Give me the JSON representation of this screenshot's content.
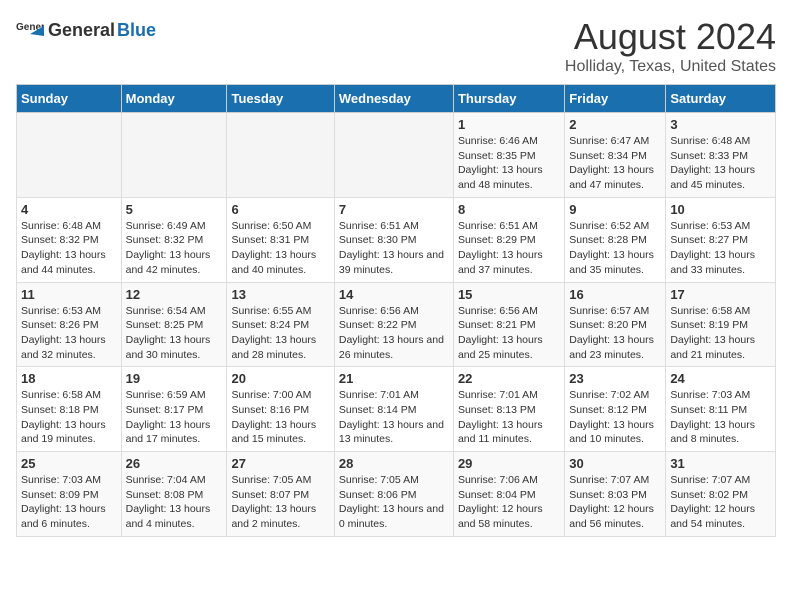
{
  "header": {
    "logo_general": "General",
    "logo_blue": "Blue",
    "title": "August 2024",
    "subtitle": "Holliday, Texas, United States"
  },
  "calendar": {
    "days_of_week": [
      "Sunday",
      "Monday",
      "Tuesday",
      "Wednesday",
      "Thursday",
      "Friday",
      "Saturday"
    ],
    "weeks": [
      [
        {
          "day": "",
          "sunrise": "",
          "sunset": "",
          "daylight": ""
        },
        {
          "day": "",
          "sunrise": "",
          "sunset": "",
          "daylight": ""
        },
        {
          "day": "",
          "sunrise": "",
          "sunset": "",
          "daylight": ""
        },
        {
          "day": "",
          "sunrise": "",
          "sunset": "",
          "daylight": ""
        },
        {
          "day": "1",
          "sunrise": "Sunrise: 6:46 AM",
          "sunset": "Sunset: 8:35 PM",
          "daylight": "Daylight: 13 hours and 48 minutes."
        },
        {
          "day": "2",
          "sunrise": "Sunrise: 6:47 AM",
          "sunset": "Sunset: 8:34 PM",
          "daylight": "Daylight: 13 hours and 47 minutes."
        },
        {
          "day": "3",
          "sunrise": "Sunrise: 6:48 AM",
          "sunset": "Sunset: 8:33 PM",
          "daylight": "Daylight: 13 hours and 45 minutes."
        }
      ],
      [
        {
          "day": "4",
          "sunrise": "Sunrise: 6:48 AM",
          "sunset": "Sunset: 8:32 PM",
          "daylight": "Daylight: 13 hours and 44 minutes."
        },
        {
          "day": "5",
          "sunrise": "Sunrise: 6:49 AM",
          "sunset": "Sunset: 8:32 PM",
          "daylight": "Daylight: 13 hours and 42 minutes."
        },
        {
          "day": "6",
          "sunrise": "Sunrise: 6:50 AM",
          "sunset": "Sunset: 8:31 PM",
          "daylight": "Daylight: 13 hours and 40 minutes."
        },
        {
          "day": "7",
          "sunrise": "Sunrise: 6:51 AM",
          "sunset": "Sunset: 8:30 PM",
          "daylight": "Daylight: 13 hours and 39 minutes."
        },
        {
          "day": "8",
          "sunrise": "Sunrise: 6:51 AM",
          "sunset": "Sunset: 8:29 PM",
          "daylight": "Daylight: 13 hours and 37 minutes."
        },
        {
          "day": "9",
          "sunrise": "Sunrise: 6:52 AM",
          "sunset": "Sunset: 8:28 PM",
          "daylight": "Daylight: 13 hours and 35 minutes."
        },
        {
          "day": "10",
          "sunrise": "Sunrise: 6:53 AM",
          "sunset": "Sunset: 8:27 PM",
          "daylight": "Daylight: 13 hours and 33 minutes."
        }
      ],
      [
        {
          "day": "11",
          "sunrise": "Sunrise: 6:53 AM",
          "sunset": "Sunset: 8:26 PM",
          "daylight": "Daylight: 13 hours and 32 minutes."
        },
        {
          "day": "12",
          "sunrise": "Sunrise: 6:54 AM",
          "sunset": "Sunset: 8:25 PM",
          "daylight": "Daylight: 13 hours and 30 minutes."
        },
        {
          "day": "13",
          "sunrise": "Sunrise: 6:55 AM",
          "sunset": "Sunset: 8:24 PM",
          "daylight": "Daylight: 13 hours and 28 minutes."
        },
        {
          "day": "14",
          "sunrise": "Sunrise: 6:56 AM",
          "sunset": "Sunset: 8:22 PM",
          "daylight": "Daylight: 13 hours and 26 minutes."
        },
        {
          "day": "15",
          "sunrise": "Sunrise: 6:56 AM",
          "sunset": "Sunset: 8:21 PM",
          "daylight": "Daylight: 13 hours and 25 minutes."
        },
        {
          "day": "16",
          "sunrise": "Sunrise: 6:57 AM",
          "sunset": "Sunset: 8:20 PM",
          "daylight": "Daylight: 13 hours and 23 minutes."
        },
        {
          "day": "17",
          "sunrise": "Sunrise: 6:58 AM",
          "sunset": "Sunset: 8:19 PM",
          "daylight": "Daylight: 13 hours and 21 minutes."
        }
      ],
      [
        {
          "day": "18",
          "sunrise": "Sunrise: 6:58 AM",
          "sunset": "Sunset: 8:18 PM",
          "daylight": "Daylight: 13 hours and 19 minutes."
        },
        {
          "day": "19",
          "sunrise": "Sunrise: 6:59 AM",
          "sunset": "Sunset: 8:17 PM",
          "daylight": "Daylight: 13 hours and 17 minutes."
        },
        {
          "day": "20",
          "sunrise": "Sunrise: 7:00 AM",
          "sunset": "Sunset: 8:16 PM",
          "daylight": "Daylight: 13 hours and 15 minutes."
        },
        {
          "day": "21",
          "sunrise": "Sunrise: 7:01 AM",
          "sunset": "Sunset: 8:14 PM",
          "daylight": "Daylight: 13 hours and 13 minutes."
        },
        {
          "day": "22",
          "sunrise": "Sunrise: 7:01 AM",
          "sunset": "Sunset: 8:13 PM",
          "daylight": "Daylight: 13 hours and 11 minutes."
        },
        {
          "day": "23",
          "sunrise": "Sunrise: 7:02 AM",
          "sunset": "Sunset: 8:12 PM",
          "daylight": "Daylight: 13 hours and 10 minutes."
        },
        {
          "day": "24",
          "sunrise": "Sunrise: 7:03 AM",
          "sunset": "Sunset: 8:11 PM",
          "daylight": "Daylight: 13 hours and 8 minutes."
        }
      ],
      [
        {
          "day": "25",
          "sunrise": "Sunrise: 7:03 AM",
          "sunset": "Sunset: 8:09 PM",
          "daylight": "Daylight: 13 hours and 6 minutes."
        },
        {
          "day": "26",
          "sunrise": "Sunrise: 7:04 AM",
          "sunset": "Sunset: 8:08 PM",
          "daylight": "Daylight: 13 hours and 4 minutes."
        },
        {
          "day": "27",
          "sunrise": "Sunrise: 7:05 AM",
          "sunset": "Sunset: 8:07 PM",
          "daylight": "Daylight: 13 hours and 2 minutes."
        },
        {
          "day": "28",
          "sunrise": "Sunrise: 7:05 AM",
          "sunset": "Sunset: 8:06 PM",
          "daylight": "Daylight: 13 hours and 0 minutes."
        },
        {
          "day": "29",
          "sunrise": "Sunrise: 7:06 AM",
          "sunset": "Sunset: 8:04 PM",
          "daylight": "Daylight: 12 hours and 58 minutes."
        },
        {
          "day": "30",
          "sunrise": "Sunrise: 7:07 AM",
          "sunset": "Sunset: 8:03 PM",
          "daylight": "Daylight: 12 hours and 56 minutes."
        },
        {
          "day": "31",
          "sunrise": "Sunrise: 7:07 AM",
          "sunset": "Sunset: 8:02 PM",
          "daylight": "Daylight: 12 hours and 54 minutes."
        }
      ]
    ]
  }
}
